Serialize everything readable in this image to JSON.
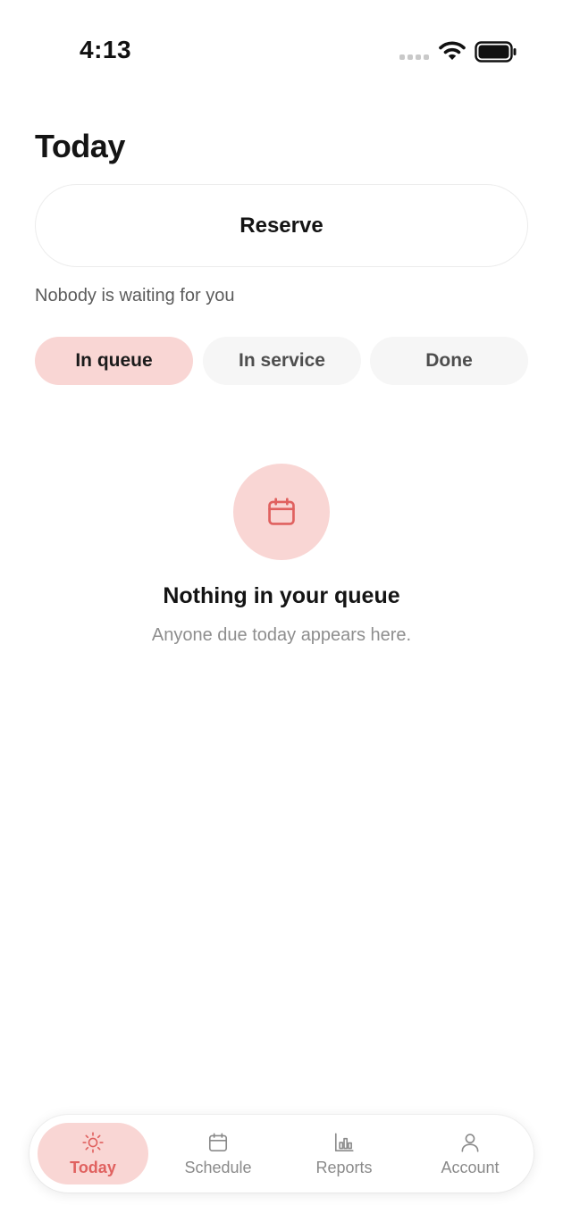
{
  "status_bar": {
    "time": "4:13"
  },
  "header": {
    "title": "Today"
  },
  "reserve": {
    "label": "Reserve"
  },
  "waiting": {
    "text": "Nobody is waiting for you"
  },
  "tabs": [
    {
      "label": "In queue",
      "active": true
    },
    {
      "label": "In service",
      "active": false
    },
    {
      "label": "Done",
      "active": false
    }
  ],
  "empty_state": {
    "icon": "calendar-icon",
    "title": "Nothing in your queue",
    "subtitle": "Anyone due today appears here."
  },
  "bottom_nav": [
    {
      "label": "Today",
      "icon": "sun-icon",
      "active": true
    },
    {
      "label": "Schedule",
      "icon": "calendar-icon",
      "active": false
    },
    {
      "label": "Reports",
      "icon": "bar-chart-icon",
      "active": false
    },
    {
      "label": "Account",
      "icon": "person-icon",
      "active": false
    }
  ],
  "colors": {
    "accent": "#e0615f",
    "accent_soft": "#f9d6d4",
    "text_primary": "#141414",
    "text_secondary": "#8e8e8e"
  }
}
